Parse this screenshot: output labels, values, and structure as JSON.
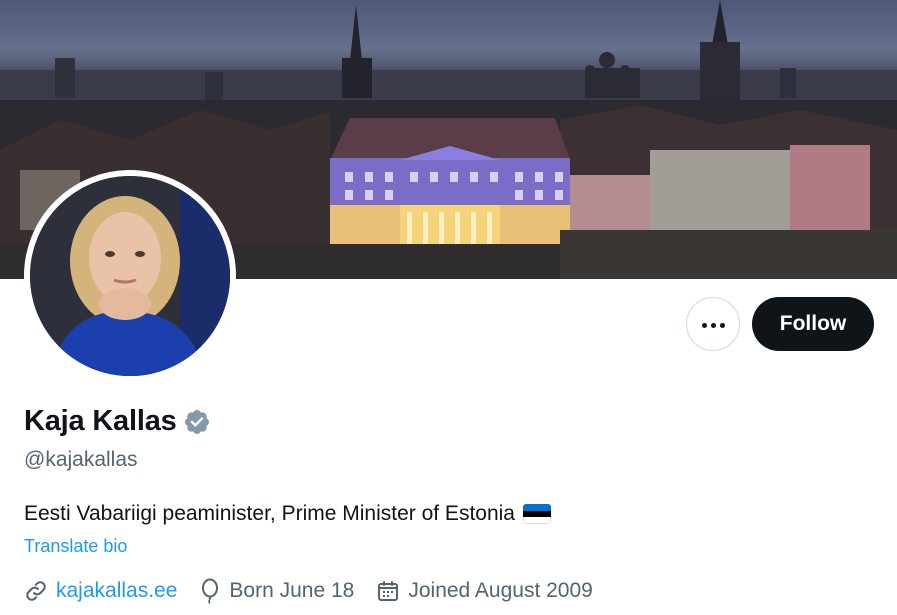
{
  "profile": {
    "display_name": "Kaja Kallas",
    "verified": true,
    "handle": "@kajakallas",
    "bio": "Eesti Vabariigi peaminister, Prime Minister of Estonia",
    "translate_label": "Translate bio",
    "website": "kajakallas.ee",
    "birthday": "Born June 18",
    "joined": "Joined August 2009"
  },
  "actions": {
    "follow_label": "Follow"
  },
  "icons": {
    "more": "more-horizontal-icon",
    "verified": "verified-badge-icon",
    "link": "link-icon",
    "birthday": "balloon-icon",
    "calendar": "calendar-icon"
  },
  "colors": {
    "accent": "#1d9bf0",
    "verified_badge": "#829aab",
    "follow_bg": "#0f1419",
    "muted_text": "#536471",
    "flag_blue": "#0072ce",
    "flag_black": "#000000",
    "flag_white": "#ffffff"
  }
}
